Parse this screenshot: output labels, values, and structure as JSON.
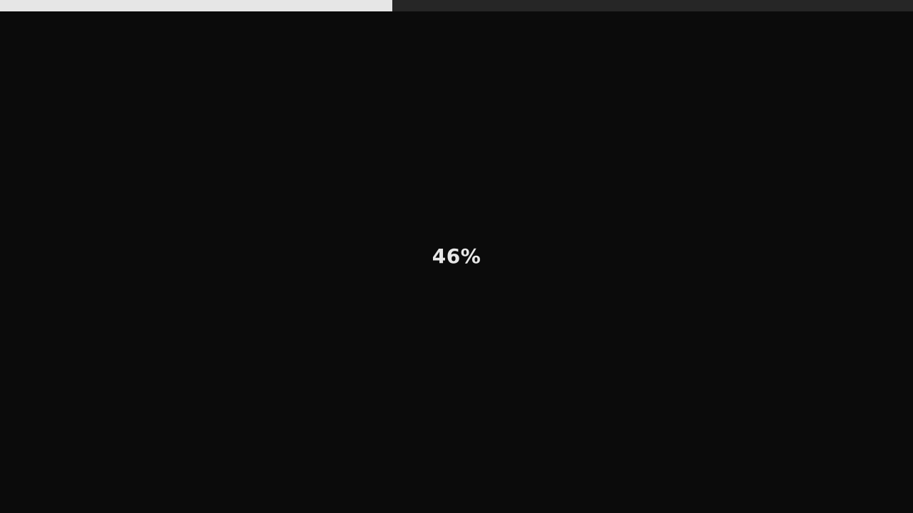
{
  "loader": {
    "progress": 0.43,
    "percent_text": "46%",
    "colors": {
      "background": "#0b0b0b",
      "track": "#262626",
      "fill": "#e6e6e6",
      "text": "#e6e6e6"
    }
  }
}
